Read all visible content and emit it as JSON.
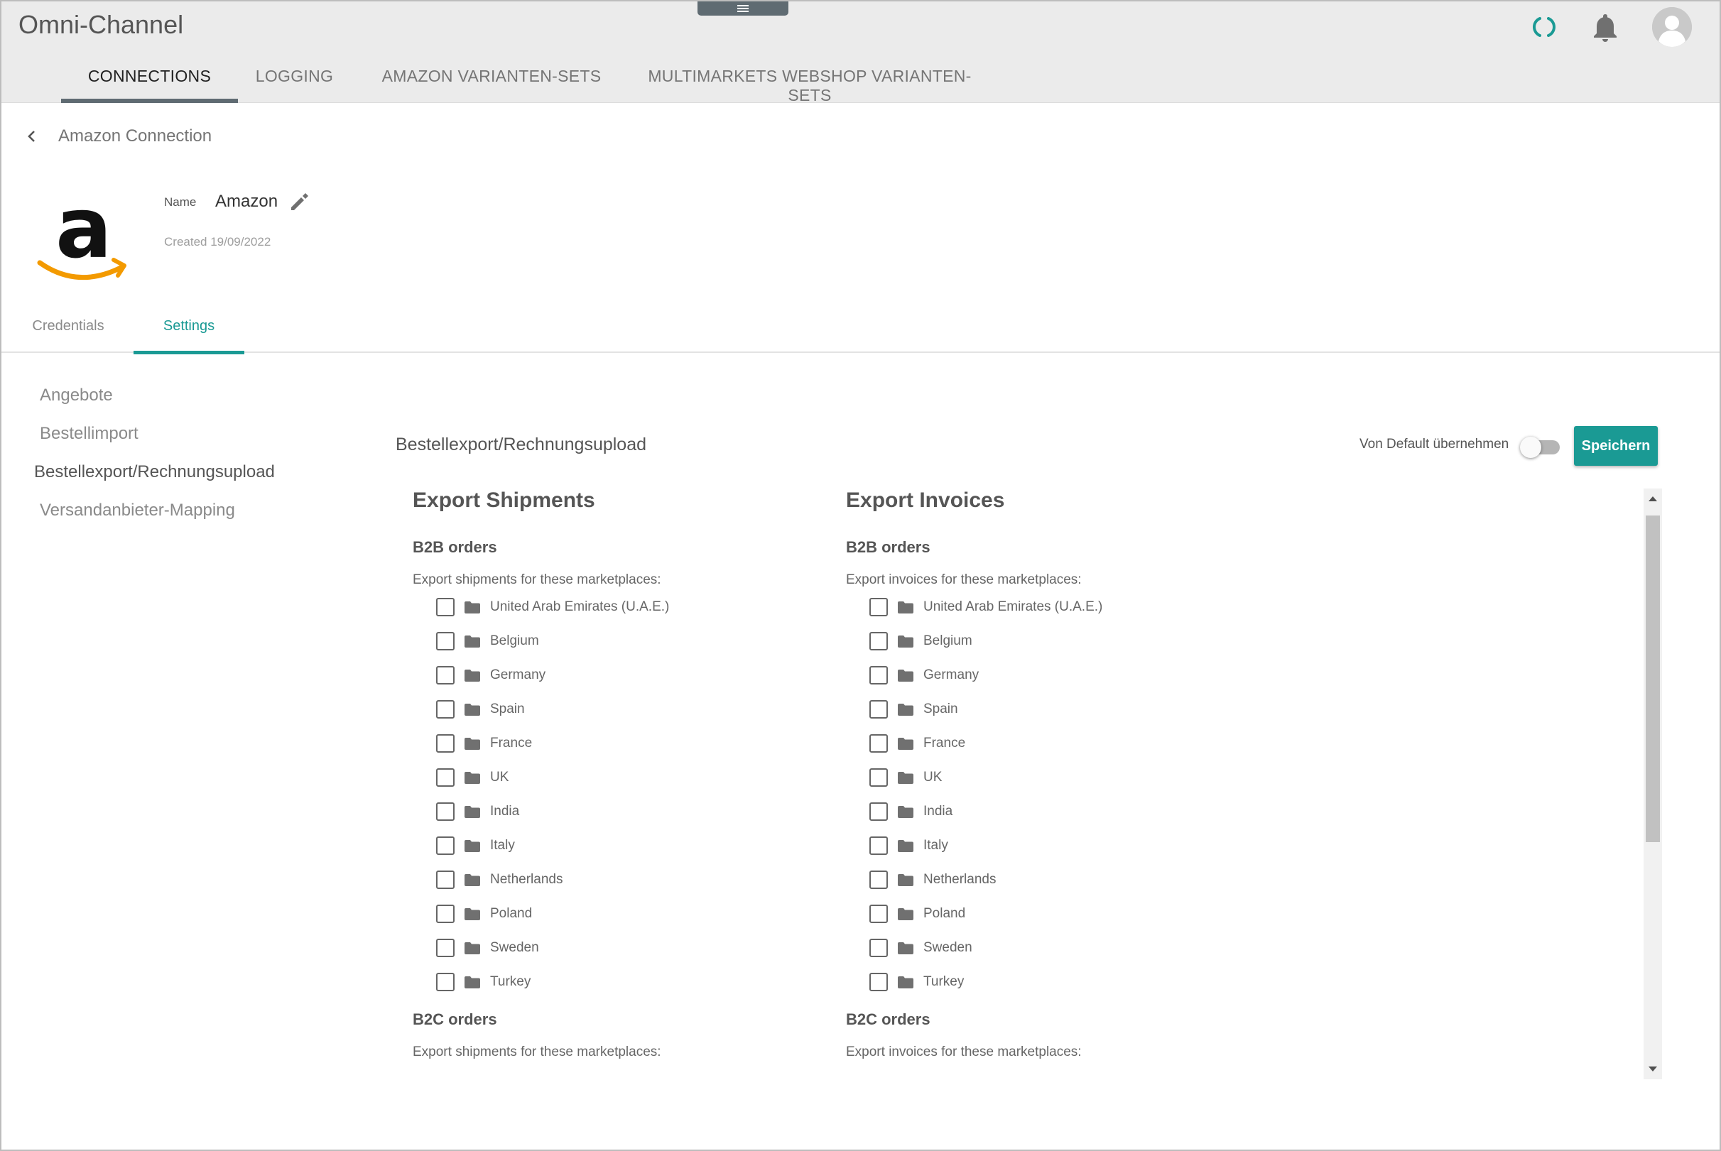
{
  "app": {
    "title": "Omni-Channel"
  },
  "nav_tabs": [
    {
      "label": "CONNECTIONS"
    },
    {
      "label": "LOGGING"
    },
    {
      "label": "AMAZON VARIANTEN-SETS"
    },
    {
      "label": "MULTIMARKETS WEBSHOP VARIANTEN-SETS"
    }
  ],
  "header_icons": [
    "sync-icon",
    "bell-icon",
    "user-avatar-icon"
  ],
  "breadcrumb": {
    "label": "Amazon Connection"
  },
  "connection": {
    "name_label": "Name",
    "name_value": "Amazon",
    "created": "Created 19/09/2022",
    "logo_letter": "a"
  },
  "sub_tabs": [
    {
      "label": "Credentials"
    },
    {
      "label": "Settings"
    }
  ],
  "side_nav": [
    {
      "label": "Angebote"
    },
    {
      "label": "Bestellimport"
    },
    {
      "label": "Bestellexport/Rechnungsupload"
    },
    {
      "label": "Versandanbieter-Mapping"
    }
  ],
  "content": {
    "section_title": "Bestellexport/Rechnungsupload",
    "default_toggle_label": "Von Default übernehmen",
    "default_toggle_on": false,
    "save_label": "Speichern",
    "accent_color": "#1a9a94"
  },
  "columns": [
    {
      "title": "Export Shipments",
      "groups": [
        {
          "title": "B2B orders",
          "desc": "Export shipments for these marketplaces:"
        },
        {
          "title": "B2C orders",
          "desc": "Export shipments for these marketplaces:"
        }
      ]
    },
    {
      "title": "Export Invoices",
      "groups": [
        {
          "title": "B2B orders",
          "desc": "Export invoices for these marketplaces:"
        },
        {
          "title": "B2C orders",
          "desc": "Export invoices for these marketplaces:"
        }
      ]
    }
  ],
  "marketplaces": [
    "United Arab Emirates (U.A.E.)",
    "Belgium",
    "Germany",
    "Spain",
    "France",
    "UK",
    "India",
    "Italy",
    "Netherlands",
    "Poland",
    "Sweden",
    "Turkey"
  ]
}
